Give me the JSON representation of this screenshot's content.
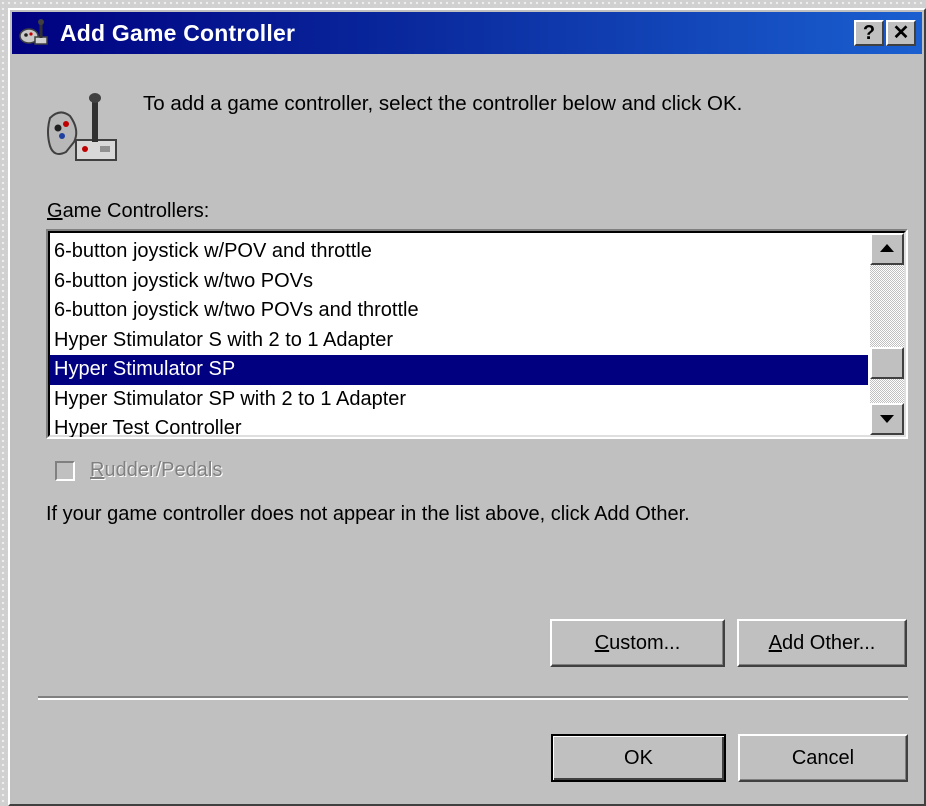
{
  "window": {
    "title": "Add Game Controller",
    "help_button": "?",
    "close_button": "✕"
  },
  "intro_text": "To add a game controller, select the controller below and click OK.",
  "list": {
    "label_accel": "G",
    "label_rest": "ame Controllers:",
    "items": [
      "6-button joystick w/POV and throttle",
      "6-button joystick w/two POVs",
      "6-button joystick w/two POVs and throttle",
      "Hyper Stimulator S with 2 to 1 Adapter",
      "Hyper Stimulator SP",
      "Hyper Stimulator SP with 2 to 1 Adapter",
      "Hyper Test Controller"
    ],
    "selected_index": 4
  },
  "rudder": {
    "label_accel": "R",
    "label_rest": "udder/Pedals",
    "checked": false,
    "enabled": false
  },
  "hint_text": "If your game controller does not appear in the list above, click Add Other.",
  "buttons": {
    "custom_accel": "C",
    "custom_rest": "ustom...",
    "add_other_accel": "A",
    "add_other_rest": "dd Other...",
    "ok": "OK",
    "cancel": "Cancel"
  },
  "colors": {
    "face": "#c0c0c0",
    "title_start": "#000080",
    "title_end": "#1a5fd0",
    "selection": "#000080"
  },
  "icons": {
    "title": "game-controller-icon",
    "main": "joystick-gamepad-icon"
  }
}
